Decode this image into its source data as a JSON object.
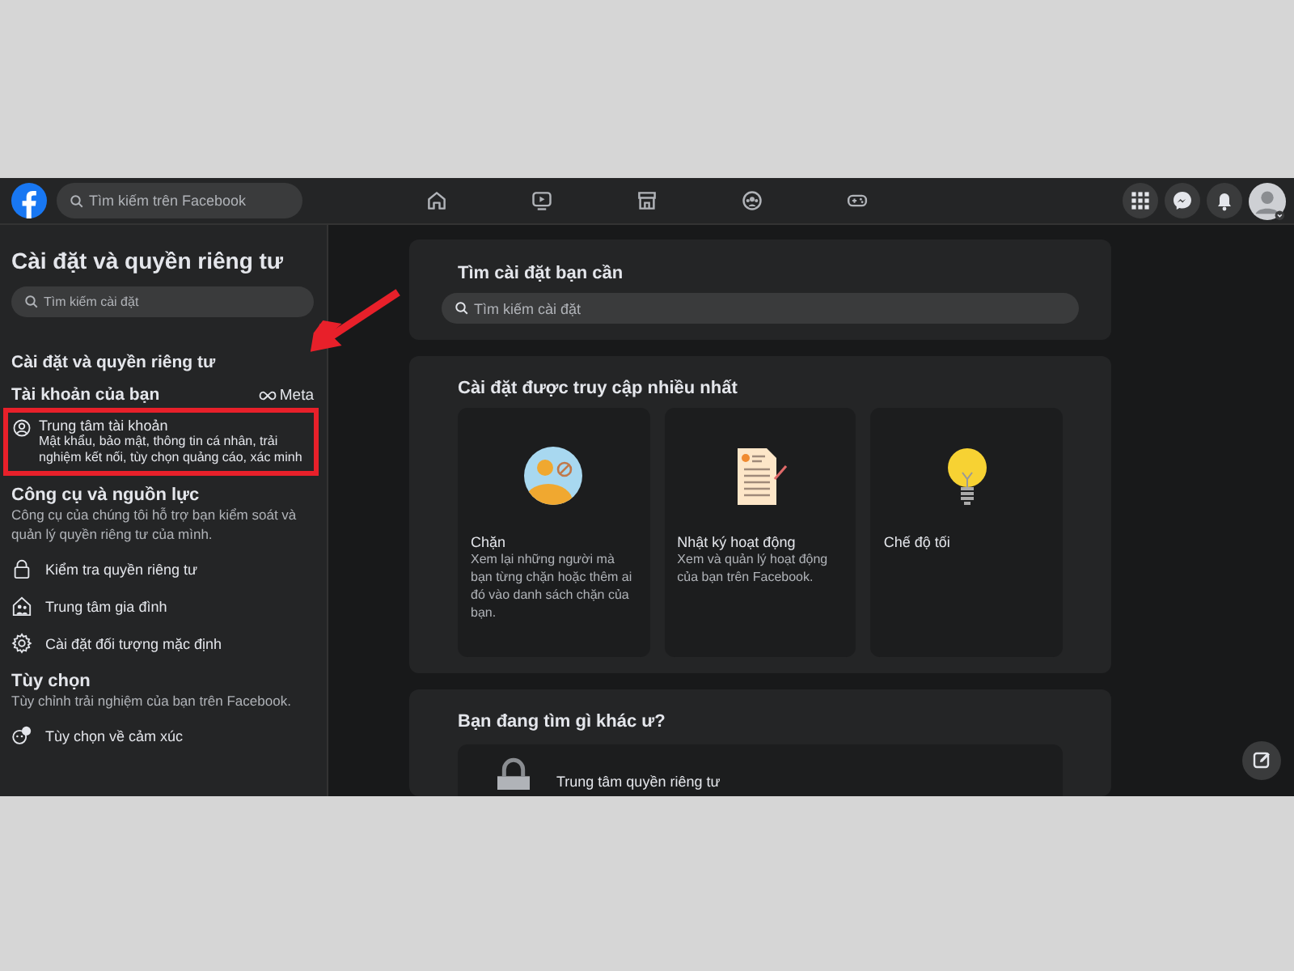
{
  "topbar": {
    "search": {
      "placeholder": "Tìm kiếm trên Facebook"
    }
  },
  "sidebar": {
    "title": "Cài đặt và quyền riêng tư",
    "search": {
      "placeholder": "Tìm kiếm cài đặt"
    },
    "section_title": "Cài đặt và quyền riêng tư",
    "account": {
      "heading": "Tài khoản của bạn",
      "brand": "Meta",
      "center": {
        "title": "Trung tâm tài khoản",
        "description": "Mật khẩu, bảo mật, thông tin cá nhân, trải nghiệm kết nối, tùy chọn quảng cáo, xác minh"
      }
    },
    "tools": {
      "heading": "Công cụ và nguồn lực",
      "description": "Công cụ của chúng tôi hỗ trợ bạn kiểm soát và quản lý quyền riêng tư của mình.",
      "items": [
        {
          "kind": "lock",
          "label": "Kiểm tra quyền riêng tư"
        },
        {
          "kind": "family",
          "label": "Trung tâm gia đình"
        },
        {
          "kind": "gear",
          "label": "Cài đặt đối tượng mặc định"
        }
      ]
    },
    "preferences": {
      "heading": "Tùy chọn",
      "description": "Tùy chỉnh trải nghiệm của bạn trên Facebook.",
      "items": [
        {
          "kind": "reaction",
          "label": "Tùy chọn về cảm xúc"
        }
      ]
    }
  },
  "main": {
    "search_card": {
      "title": "Tìm cài đặt bạn cần",
      "placeholder": "Tìm kiếm cài đặt"
    },
    "frequent": {
      "heading": "Cài đặt được truy cập nhiều nhất",
      "cards": [
        {
          "kind": "block",
          "title": "Chặn",
          "description": "Xem lại những người mà bạn từng chặn hoặc thêm ai đó vào danh sách chặn của bạn."
        },
        {
          "kind": "log",
          "title": "Nhật ký hoạt động",
          "description": "Xem và quản lý hoạt động của bạn trên Facebook."
        },
        {
          "kind": "dark",
          "title": "Chế độ tối"
        }
      ]
    },
    "other": {
      "heading": "Bạn đang tìm gì khác ư?",
      "items": [
        {
          "kind": "lock",
          "title": "Trung tâm quyền riêng tư"
        }
      ]
    }
  }
}
